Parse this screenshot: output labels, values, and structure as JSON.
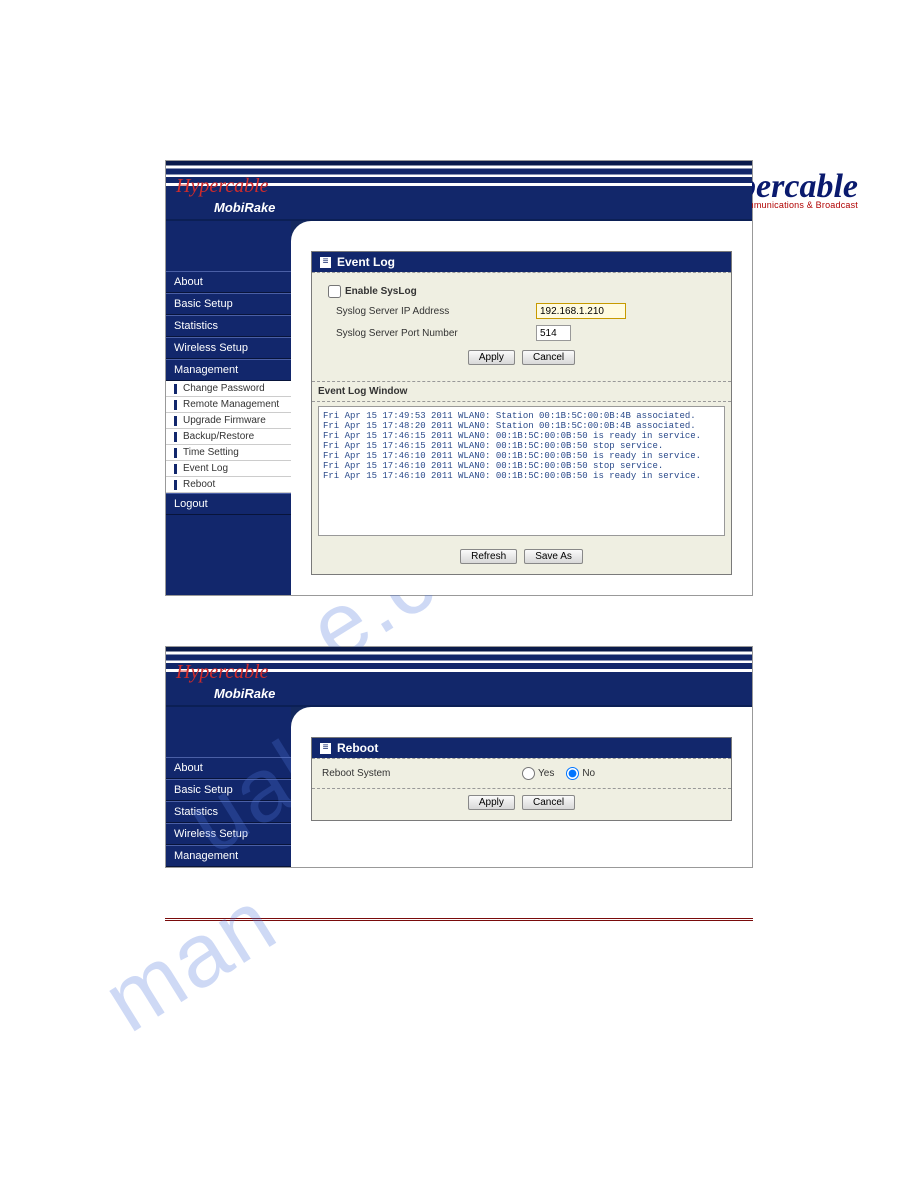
{
  "topLogo": {
    "brand": "Hypercable",
    "tagline": "Telecommunications & Broadcast"
  },
  "banner": {
    "brand": "Hypercable",
    "product": "MobiRake"
  },
  "nav": {
    "items": [
      {
        "label": "About"
      },
      {
        "label": "Basic Setup"
      },
      {
        "label": "Statistics"
      },
      {
        "label": "Wireless Setup"
      },
      {
        "label": "Management"
      }
    ],
    "sub": [
      {
        "label": "Change Password"
      },
      {
        "label": "Remote Management"
      },
      {
        "label": "Upgrade Firmware"
      },
      {
        "label": "Backup/Restore"
      },
      {
        "label": "Time Setting"
      },
      {
        "label": "Event Log"
      },
      {
        "label": "Reboot"
      }
    ],
    "logout": "Logout"
  },
  "eventLog": {
    "title": "Event Log",
    "enable": "Enable SysLog",
    "ipLabel": "Syslog Server IP Address",
    "ipValue": "192.168.1.210",
    "portLabel": "Syslog Server Port Number",
    "portValue": "514",
    "apply": "Apply",
    "cancel": "Cancel",
    "windowLabel": "Event Log Window",
    "log": "Fri Apr 15 17:49:53 2011 WLAN0: Station 00:1B:5C:00:0B:4B associated.\nFri Apr 15 17:48:20 2011 WLAN0: Station 00:1B:5C:00:0B:4B associated.\nFri Apr 15 17:46:15 2011 WLAN0: 00:1B:5C:00:0B:50 is ready in service.\nFri Apr 15 17:46:15 2011 WLAN0: 00:1B:5C:00:0B:50 stop service.\nFri Apr 15 17:46:10 2011 WLAN0: 00:1B:5C:00:0B:50 is ready in service.\nFri Apr 15 17:46:10 2011 WLAN0: 00:1B:5C:00:0B:50 stop service.\nFri Apr 15 17:46:10 2011 WLAN0: 00:1B:5C:00:0B:50 is ready in service.",
    "refresh": "Refresh",
    "saveAs": "Save As"
  },
  "reboot": {
    "title": "Reboot",
    "label": "Reboot System",
    "yes": "Yes",
    "no": "No",
    "apply": "Apply",
    "cancel": "Cancel"
  },
  "watermark": {
    "a": "e.com",
    "b": "ualsh",
    "c": "man"
  }
}
